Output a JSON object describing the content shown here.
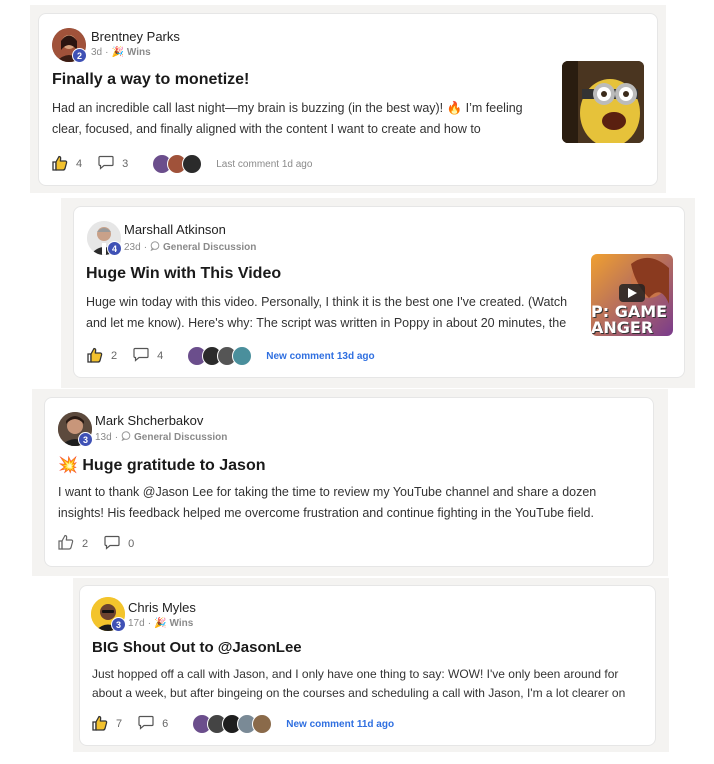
{
  "posts": [
    {
      "author": "Brentney Parks",
      "level": "2",
      "age": "3d",
      "category": "Wins",
      "category_icon": "party-popper-icon",
      "title": "Finally a way to monetize!",
      "body": "Had an incredible call last night—my brain is buzzing (in the best way)! 🔥 I’m feeling clear, focused, and finally aligned with the content I want to create and how to",
      "likes": "4",
      "comments": "3",
      "comment_status": "Last comment 1d ago",
      "liked": true
    },
    {
      "author": "Marshall Atkinson",
      "level": "4",
      "age": "23d",
      "category": "General Discussion",
      "category_icon": "speech-bubble-icon",
      "title": "Huge Win with This Video",
      "body": "Huge win today with this video. Personally, I think it is the best one I've created. (Watch and let me know). Here's why: The script was written in Poppy in about 20 minutes, the",
      "likes": "2",
      "comments": "4",
      "comment_status": "New comment 13d ago",
      "thumb_text": [
        "P: GAME",
        "ANGER"
      ],
      "liked": true
    },
    {
      "author": "Mark Shcherbakov",
      "level": "3",
      "age": "13d",
      "category": "General Discussion",
      "category_icon": "speech-bubble-icon",
      "title_emoji": "💥",
      "title": "Huge gratitude to Jason",
      "body": "I want to thank @Jason Lee for taking the time to review my YouTube channel and share a dozen insights! His feedback helped me overcome frustration and continue fighting in the YouTube field.",
      "likes": "2",
      "comments": "0",
      "liked": false
    },
    {
      "author": "Chris Myles",
      "level": "3",
      "age": "17d",
      "category": "Wins",
      "category_icon": "party-popper-icon",
      "title": "BIG Shout Out to @JasonLee",
      "body": "Just hopped off a call with Jason, and I only have one thing to say: WOW! I've only been around for about a week, but after bingeing on the courses and scheduling a call with Jason, I'm a lot clearer on",
      "likes": "7",
      "comments": "6",
      "comment_status": "New comment 11d ago",
      "liked": true
    }
  ],
  "separator": "·",
  "colors": {
    "level_badge": "#3f51b5",
    "new_comment": "#2f6fe0",
    "like_active": "#e8a317"
  }
}
